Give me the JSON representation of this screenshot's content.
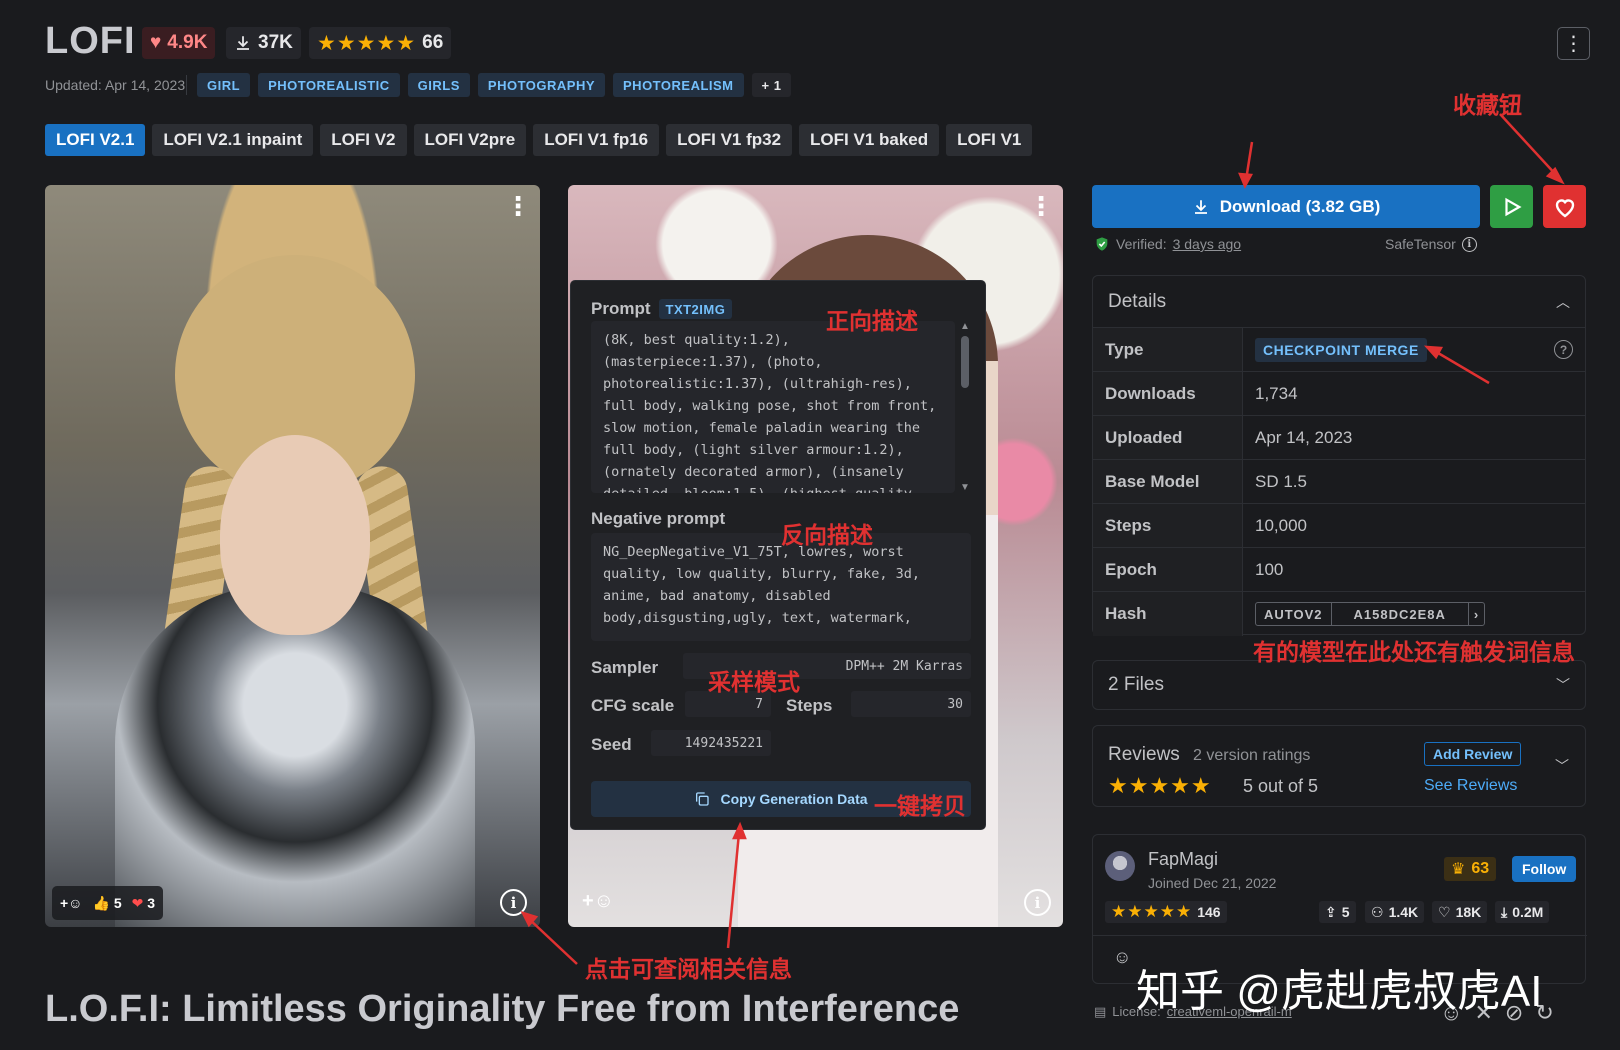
{
  "header": {
    "title": "LOFI",
    "likes": "4.9K",
    "downloads": "37K",
    "rating_stars": "★★★★★",
    "rating_count": "66",
    "updated": "Updated: Apr 14, 2023",
    "tags": [
      "GIRL",
      "PHOTOREALISTIC",
      "GIRLS",
      "PHOTOGRAPHY",
      "PHOTOREALISM",
      "+ 1"
    ]
  },
  "versions": [
    "LOFI V2.1",
    "LOFI V2.1 inpaint",
    "LOFI V2",
    "LOFI V2pre",
    "LOFI V1 fp16",
    "LOFI V1 fp32",
    "LOFI V1 baked",
    "LOFI V1"
  ],
  "image1": {
    "thumbs_up": "5",
    "hearts": "3"
  },
  "generation": {
    "prompt_label": "Prompt",
    "prompt_badge": "TXT2IMG",
    "prompt_text": "(8K, best quality:1.2), (masterpiece:1.37), (photo, photorealistic:1.37), (ultrahigh-res), full body, walking pose, shot from front, slow motion, female paladin wearing the full body, (light silver armour:1.2), (ornately decorated armor), (insanely detailed, bloom:1.5), (highest quality",
    "negative_label": "Negative prompt",
    "negative_text": "NG_DeepNegative_V1_75T, lowres, worst quality, low quality, blurry, fake, 3d, anime, bad anatomy, disabled body,disgusting,ugly, text, watermark,",
    "sampler_label": "Sampler",
    "sampler": "DPM++ 2M Karras",
    "cfg_label": "CFG scale",
    "cfg": "7",
    "steps_label": "Steps",
    "steps": "30",
    "seed_label": "Seed",
    "seed": "1492435221",
    "copy_label": "Copy Generation Data"
  },
  "actions": {
    "download": "Download (3.82 GB)",
    "verified_prefix": "Verified:",
    "verified_when": "3 days ago",
    "safetensor": "SafeTensor"
  },
  "details": {
    "title": "Details",
    "rows": [
      {
        "k": "Type",
        "v": "CHECKPOINT MERGE"
      },
      {
        "k": "Downloads",
        "v": "1,734"
      },
      {
        "k": "Uploaded",
        "v": "Apr 14, 2023"
      },
      {
        "k": "Base Model",
        "v": "SD 1.5"
      },
      {
        "k": "Steps",
        "v": "10,000"
      },
      {
        "k": "Epoch",
        "v": "100"
      },
      {
        "k": "Hash",
        "v": ""
      }
    ],
    "hash_type": "AUTOV2",
    "hash_value": "A158DC2E8A"
  },
  "files": {
    "label": "2 Files"
  },
  "reviews": {
    "title": "Reviews",
    "subtitle": "2 version ratings",
    "stars": "★★★★★",
    "score": "5 out of 5",
    "add": "Add Review",
    "see": "See Reviews"
  },
  "user": {
    "name": "FapMagi",
    "joined": "Joined Dec 21, 2022",
    "crown": "63",
    "follow": "Follow",
    "stars": "★★★★★",
    "rating": "146",
    "uploads": "5",
    "followers": "1.4K",
    "favorites": "18K",
    "downloads": "0.2M"
  },
  "license": {
    "prefix": "License:",
    "name": "creativeml-openrail-m"
  },
  "page_title": "L.O.F.I: Limitless Originality Free from Interference",
  "watermark": "知乎 @虎赳虎叔虎AI",
  "annotations": {
    "favorite": "收藏钮",
    "positive": "正向描述",
    "negative": "反向描述",
    "sampler": "采样模式",
    "copy": "一键拷贝",
    "info": "点击可查阅相关信息",
    "trigger": "有的模型在此处还有触发词信息"
  }
}
